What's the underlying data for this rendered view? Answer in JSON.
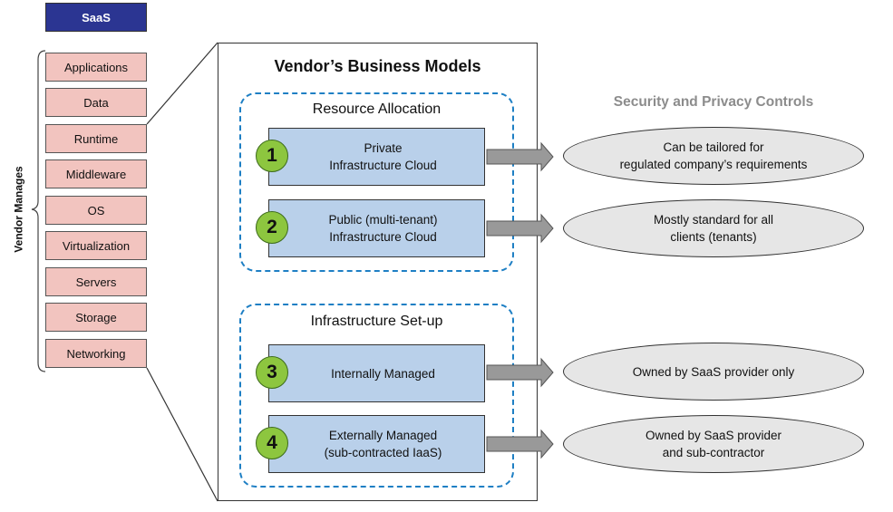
{
  "service_model": {
    "label": "SaaS",
    "color": "#2b3592"
  },
  "stack": {
    "bracket_label": "Vendor Manages",
    "layers": [
      {
        "label": "Applications"
      },
      {
        "label": "Data"
      },
      {
        "label": "Runtime"
      },
      {
        "label": "Middleware"
      },
      {
        "label": "OS"
      },
      {
        "label": "Virtualization"
      },
      {
        "label": "Servers"
      },
      {
        "label": "Storage"
      },
      {
        "label": "Networking"
      }
    ],
    "layer_color": "#f2c4bf"
  },
  "business_models": {
    "title": "Vendor’s Business Models",
    "groups": [
      {
        "label": "Resource Allocation",
        "models": [
          {
            "number": "1",
            "label": "Private\nInfrastructure Cloud"
          },
          {
            "number": "2",
            "label": "Public (multi-tenant)\nInfrastructure Cloud"
          }
        ]
      },
      {
        "label": "Infrastructure Set-up",
        "models": [
          {
            "number": "3",
            "label": "Internally Managed"
          },
          {
            "number": "4",
            "label": "Externally Managed\n(sub-contracted IaaS)"
          }
        ]
      }
    ],
    "group_border_color": "#1e7fc4",
    "model_color": "#b9d0ea",
    "badge_color": "#8dc63f"
  },
  "controls": {
    "title": "Security and Privacy Controls",
    "title_color": "#8c8c8c",
    "items": [
      {
        "label": "Can be tailored for\nregulated company’s requirements"
      },
      {
        "label": "Mostly standard for all\nclients (tenants)"
      },
      {
        "label": "Owned by SaaS provider only"
      },
      {
        "label": "Owned by SaaS provider\nand sub-contractor"
      }
    ],
    "arrow_color": "#999999",
    "ellipse_color": "#e6e6e6"
  }
}
